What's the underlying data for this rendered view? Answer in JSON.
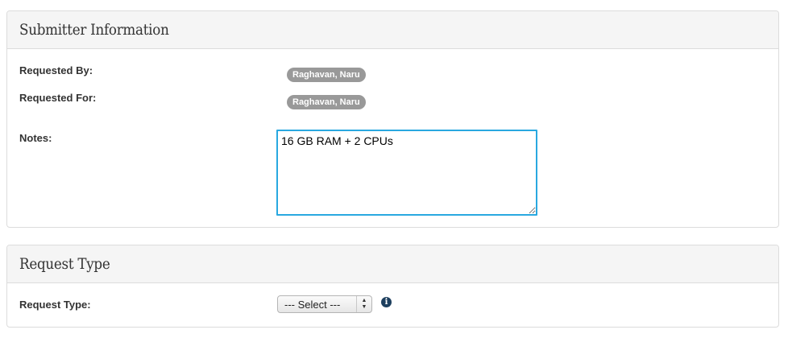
{
  "submitter_section": {
    "title": "Submitter Information",
    "requested_by_label": "Requested By:",
    "requested_by_value": "Raghavan, Naru",
    "requested_for_label": "Requested For:",
    "requested_for_value": "Raghavan, Naru",
    "notes_label": "Notes:",
    "notes_value": "16 GB RAM + 2 CPUs"
  },
  "request_type_section": {
    "title": "Request Type",
    "request_type_label": "Request Type:",
    "request_type_selected": "--- Select ---",
    "info_icon": "info-circle-icon"
  },
  "colors": {
    "badge_background": "#999999",
    "focus_border": "#29a8e0",
    "info_icon": "#1d3f5e",
    "panel_heading_background": "#f5f5f5"
  }
}
